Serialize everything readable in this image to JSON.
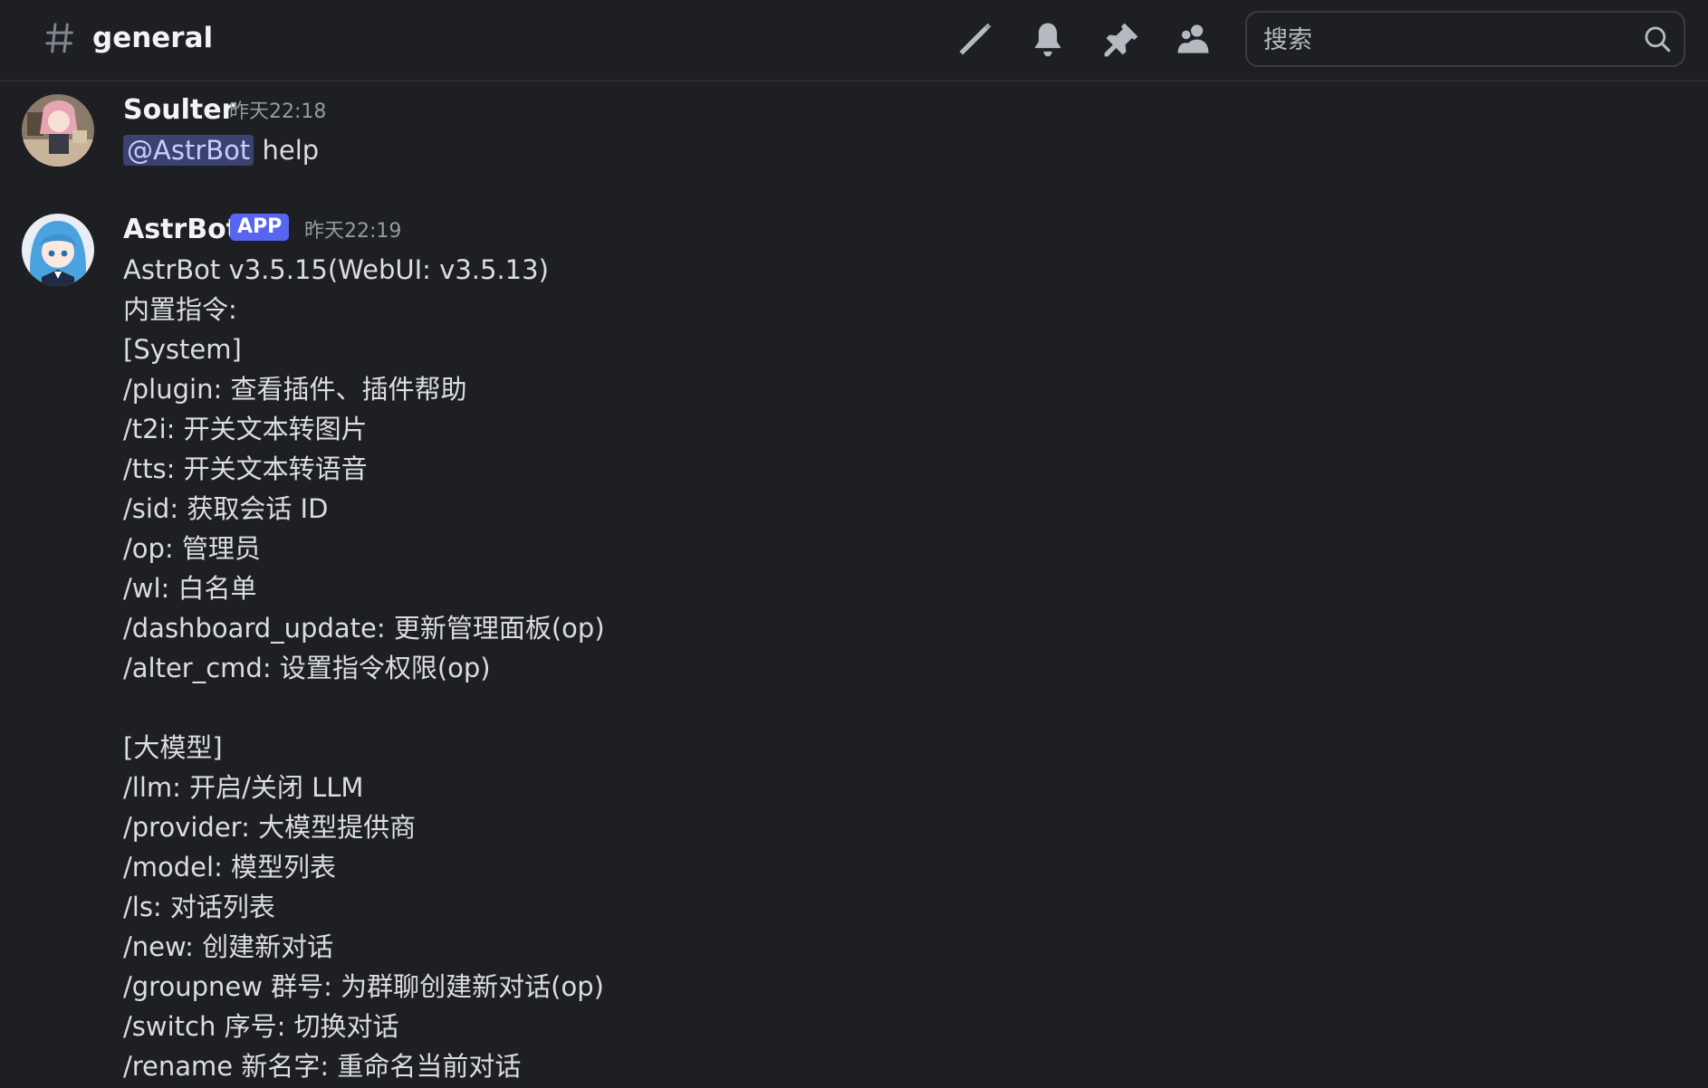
{
  "header": {
    "channel_name": "general",
    "icons": [
      "threads-icon",
      "bell-icon",
      "pin-icon",
      "members-icon"
    ],
    "search": {
      "placeholder": "搜索"
    }
  },
  "messages": [
    {
      "author": "Soulter",
      "timestamp": "昨天22:18",
      "mention": "@AstrBot",
      "text": "help"
    },
    {
      "author": "AstrBot",
      "badge": "APP",
      "timestamp": "昨天22:19",
      "lines": [
        "AstrBot v3.5.15(WebUI: v3.5.13)",
        "内置指令:",
        "[System]",
        "/plugin: 查看插件、插件帮助",
        "/t2i: 开关文本转图片",
        "/tts: 开关文本转语音",
        "/sid: 获取会话 ID",
        "/op: 管理员",
        "/wl: 白名单",
        "/dashboard_update: 更新管理面板(op)",
        "/alter_cmd: 设置指令权限(op)",
        "",
        "[大模型]",
        "/llm: 开启/关闭 LLM",
        "/provider: 大模型提供商",
        "/model: 模型列表",
        "/ls: 对话列表",
        "/new: 创建新对话",
        "/groupnew 群号: 为群聊创建新对话(op)",
        "/switch 序号: 切换对话",
        "/rename 新名字: 重命名当前对话"
      ]
    }
  ],
  "colors": {
    "background": "#1e1f23",
    "app_badge": "#5865f2",
    "mention_bg": "#3c4270",
    "mention_text": "#c9cdfb"
  }
}
